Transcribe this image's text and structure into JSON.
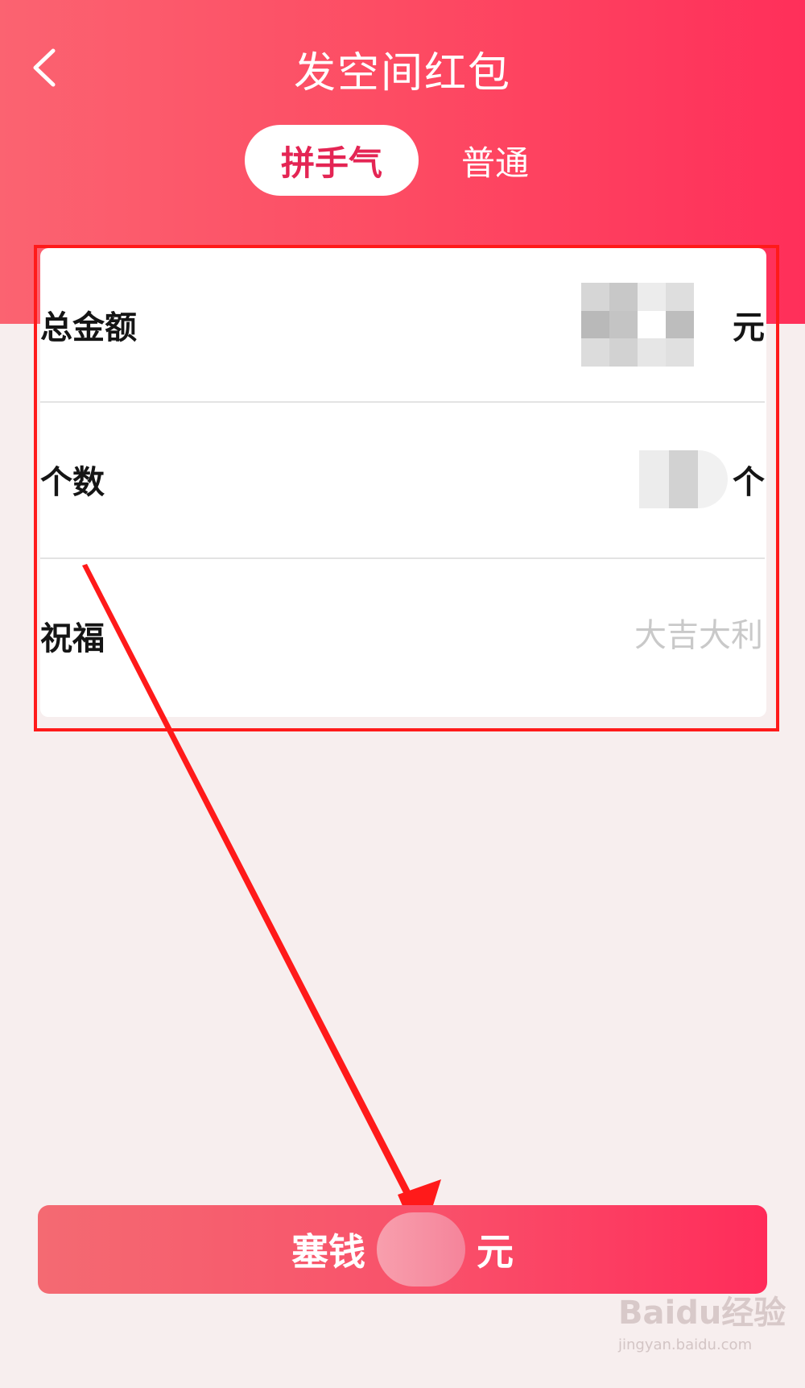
{
  "header": {
    "title": "发空间红包",
    "tabs": [
      {
        "label": "拼手气",
        "active": true
      },
      {
        "label": "普通",
        "active": false
      }
    ]
  },
  "form": {
    "total_amount": {
      "label": "总金额",
      "unit": "元"
    },
    "count": {
      "label": "个数",
      "unit": "个"
    },
    "greeting": {
      "label": "祝福",
      "placeholder": "大吉大利"
    }
  },
  "submit": {
    "prefix": "塞钱",
    "suffix": "元"
  },
  "watermark": {
    "brand": "Baidu经验",
    "url": "jingyan.baidu.com"
  },
  "colors": {
    "header_start": "#fb6371",
    "header_end": "#ff2f5a",
    "active_tab_text": "#e42554",
    "annotation_red": "#ff1a1a",
    "page_bg": "#f7eeee"
  },
  "icons": {
    "back": "chevron-left-icon"
  }
}
